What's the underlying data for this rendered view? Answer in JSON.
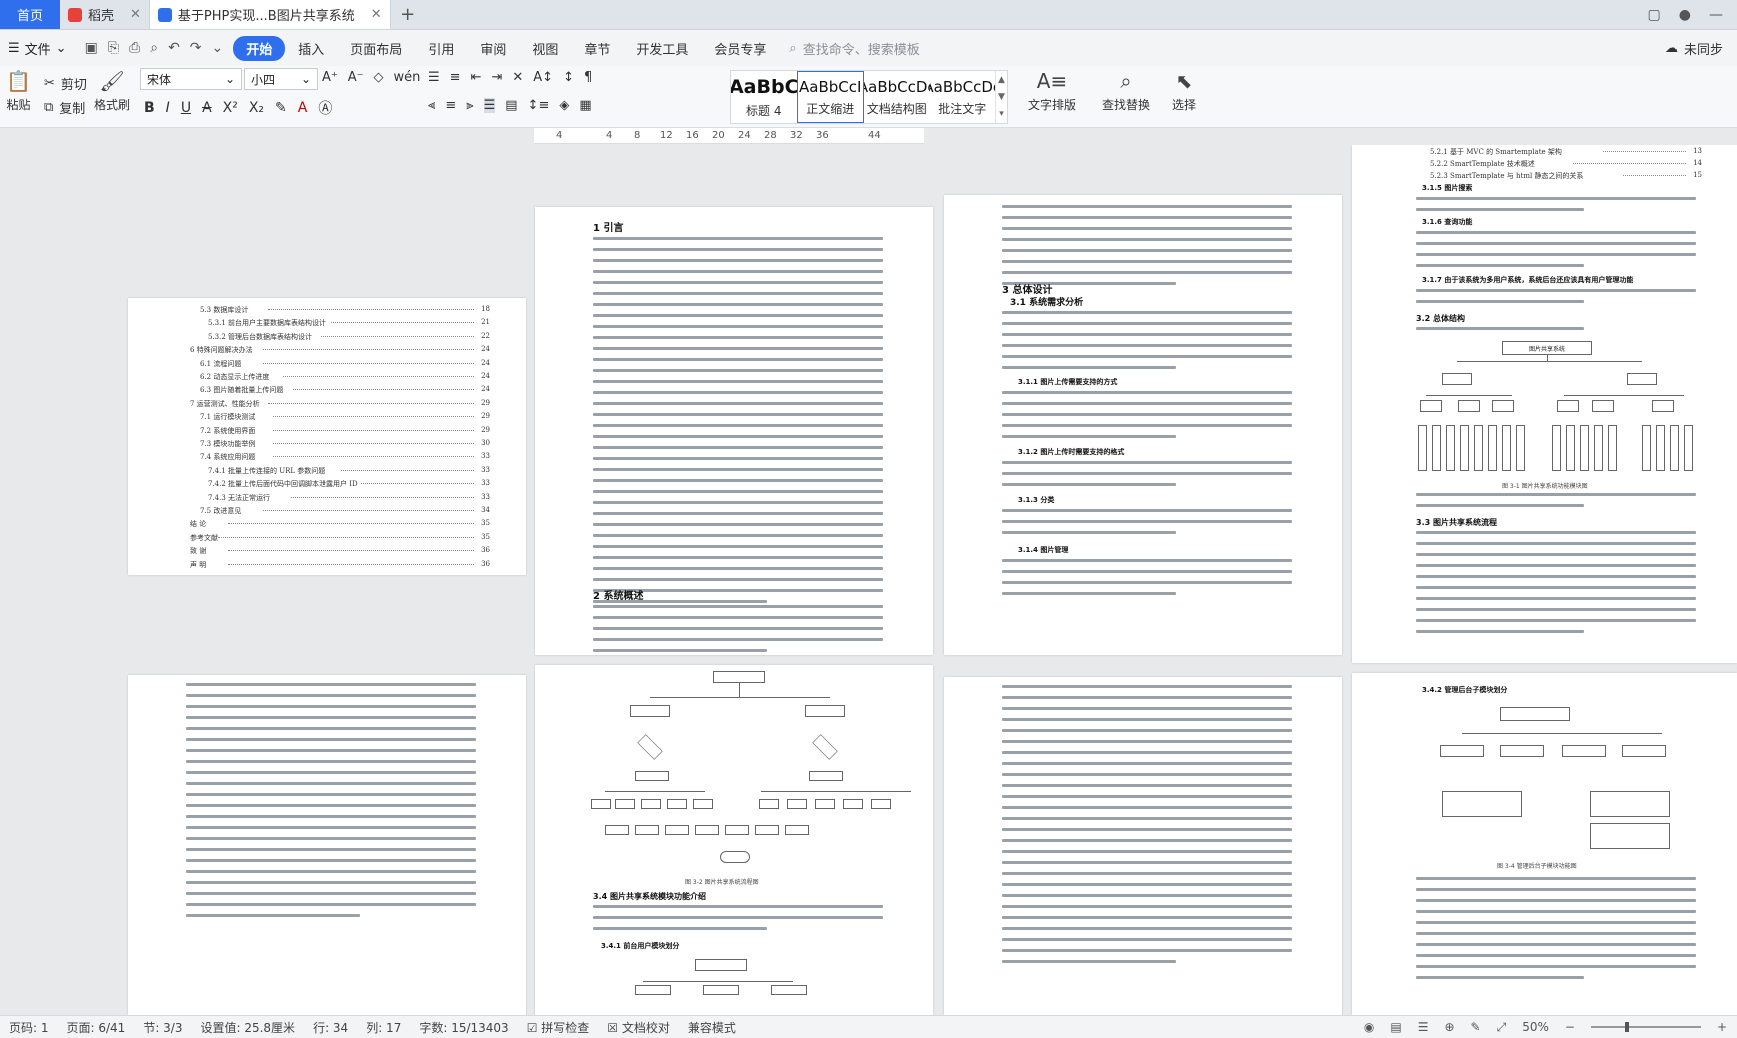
{
  "tabs": {
    "home": "首页",
    "tab1": "稻壳",
    "tab2": "基于PHP实现...B图片共享系统"
  },
  "menu": {
    "file": "文件",
    "items": [
      "开始",
      "插入",
      "页面布局",
      "引用",
      "审阅",
      "视图",
      "章节",
      "开发工具",
      "会员专享"
    ],
    "search_placeholder": "查找命令、搜索模板",
    "sync": "未同步"
  },
  "toolbar": {
    "paste": "粘贴",
    "cut": "剪切",
    "copy": "复制",
    "format_painter": "格式刷",
    "font_name": "宋体",
    "font_size": "小四",
    "styles": [
      {
        "sample": "AaBbC",
        "name": "标题 4"
      },
      {
        "sample": "AaBbCcI",
        "name": "正文缩进"
      },
      {
        "sample": "AaBbCcDc",
        "name": "文档结构图"
      },
      {
        "sample": "AaBbCcDc",
        "name": "批注文字"
      }
    ],
    "text_layout": "文字排版",
    "find_replace": "查找替换",
    "select": "选择"
  },
  "ruler": [
    "4",
    "4",
    "8",
    "12",
    "16",
    "20",
    "24",
    "28",
    "32",
    "36",
    "44"
  ],
  "page1": {
    "toc": [
      {
        "t": "5.3    数据库设计",
        "p": "18"
      },
      {
        "t": "5.3.1    前台用户主要数据库表结构设计",
        "p": "21"
      },
      {
        "t": "5.3.2    管理后台数据库表结构设计",
        "p": "22"
      },
      {
        "t": "6    特殊问题解决办法",
        "p": "24"
      },
      {
        "t": "6.1    流程问题",
        "p": "24"
      },
      {
        "t": "6.2    动态显示上传进度",
        "p": "24"
      },
      {
        "t": "6.3    图片随着批量上传问题",
        "p": "24"
      },
      {
        "t": "7    运营测试、性能分析",
        "p": "29"
      },
      {
        "t": "7.1    运行模块测试",
        "p": "29"
      },
      {
        "t": "7.2    系统使用界面",
        "p": "29"
      },
      {
        "t": "7.3    模块功能举例",
        "p": "30"
      },
      {
        "t": "7.4    系统应用问题",
        "p": "33"
      },
      {
        "t": "7.4.1    批量上传连接的 URL 参数问题",
        "p": "33"
      },
      {
        "t": "7.4.2    批量上传后面代码中回调脚本泄露用户 ID",
        "p": "33"
      },
      {
        "t": "7.4.3    无法正常运行",
        "p": "33"
      },
      {
        "t": "7.5    改进意见",
        "p": "34"
      },
      {
        "t": "结    论",
        "p": "35"
      },
      {
        "t": "参考文献",
        "p": "35"
      },
      {
        "t": "致    谢",
        "p": "36"
      },
      {
        "t": "声    明",
        "p": "36"
      }
    ]
  },
  "page2": {
    "h1_intro": "1  引言",
    "h1_overview": "2  系统概述"
  },
  "page3": {
    "h1_design": "3  总体设计",
    "h2_req": "3.1 系统需求分析",
    "h3_a": "3.1.1    图片上传需要支持的方式",
    "h3_b": "3.1.2    图片上传时需要支持的格式",
    "h3_c": "3.1.3    分类",
    "h3_d": "3.1.4    图片管理"
  },
  "page4": {
    "toc": [
      {
        "t": "5.2.1    基于 MVC 的 Smartemplate 架构",
        "p": "13"
      },
      {
        "t": "5.2.2    SmartTemplate 技术概述",
        "p": "14"
      },
      {
        "t": "5.2.3    SmartTemplate 与 html 静态之间的关系",
        "p": "15"
      }
    ],
    "h3_a": "3.1.5    图片搜索",
    "h3_b": "3.1.6    查询功能",
    "h3_c": "3.1.7    由于该系统为多用户系统，系统后台还应该具有用户管理功能",
    "h2_a": "3.2 总体结构",
    "fig_title": "图片共享系统",
    "fig_caption": "图 3-1  图片共享系统功能模块图",
    "h2_b": "3.3 图片共享系统流程"
  },
  "page6": {
    "fig_caption": "图 3-2  图片共享系统流程图",
    "h2": "3.4  图片共享系统模块功能介绍",
    "h3": "3.4.1    前台用户模块划分"
  },
  "page8": {
    "h3": "3.4.2    管理后台子模块划分",
    "fig_caption": "图 3-4 管理后台子模块功能图"
  },
  "status": {
    "page_num": "页码: 1",
    "page": "页面: 6/41",
    "section": "节: 3/3",
    "setting": "设置值: 25.8厘米",
    "row": "行: 34",
    "col": "列: 17",
    "words": "字数: 15/13403",
    "spell": "拼写检查",
    "proof": "文档校对",
    "compat": "兼容模式",
    "zoom": "50%"
  }
}
